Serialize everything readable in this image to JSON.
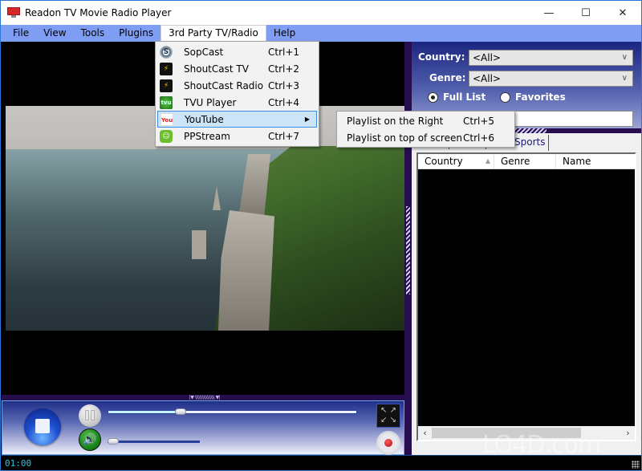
{
  "window": {
    "title": "Readon TV Movie Radio Player",
    "controls": {
      "minimize": "—",
      "maximize": "☐",
      "close": "✕"
    }
  },
  "menubar": {
    "items": [
      "File",
      "View",
      "Tools",
      "Plugins",
      "3rd Party TV/Radio",
      "Help"
    ],
    "open_index": 4
  },
  "dropdown": {
    "items": [
      {
        "label": "SopCast",
        "shortcut": "Ctrl+1",
        "icon": "sopcast-icon",
        "glyph": "S"
      },
      {
        "label": "ShoutCast TV",
        "shortcut": "Ctrl+2",
        "icon": "shoutcast-icon",
        "glyph": "⚡"
      },
      {
        "label": "ShoutCast Radio",
        "shortcut": "Ctrl+3",
        "icon": "shoutcast-icon",
        "glyph": "⚡"
      },
      {
        "label": "TVU Player",
        "shortcut": "Ctrl+4",
        "icon": "tvu-icon",
        "glyph": "tvu"
      },
      {
        "label": "YouTube",
        "shortcut": "",
        "icon": "youtube-icon",
        "glyph": "You",
        "has_submenu": true,
        "highlighted": true
      },
      {
        "label": "PPStream",
        "shortcut": "Ctrl+7",
        "icon": "ppstream-icon",
        "glyph": "☺"
      }
    ],
    "submenu_arrow": "▶"
  },
  "submenu": {
    "items": [
      {
        "label": "Playlist on the Right",
        "shortcut": "Ctrl+5"
      },
      {
        "label": "Playlist on top of screen",
        "shortcut": "Ctrl+6"
      }
    ]
  },
  "player": {
    "seek_progress": 0.29,
    "volume_level": 0.0,
    "time": "01:00",
    "splitter_grip": "|▼ \\\\\\\\\\\\\\\\\\\\\\\\\\\\\\\\ ▼|"
  },
  "filter": {
    "country_label": "Country:",
    "country_value": "<All>",
    "genre_label": "Genre:",
    "genre_value": "<All>",
    "full_list_label": "Full List",
    "favorites_label": "Favorites",
    "selected_radio": "full_list",
    "search_value": ""
  },
  "tabs": {
    "visible_tab": "Sports"
  },
  "list": {
    "columns": [
      "Country",
      "Genre",
      "Name"
    ],
    "sort_indicator": "▲",
    "rows": []
  },
  "scroll": {
    "left": "‹",
    "right": "›"
  },
  "watermark": "LO4D.com"
}
